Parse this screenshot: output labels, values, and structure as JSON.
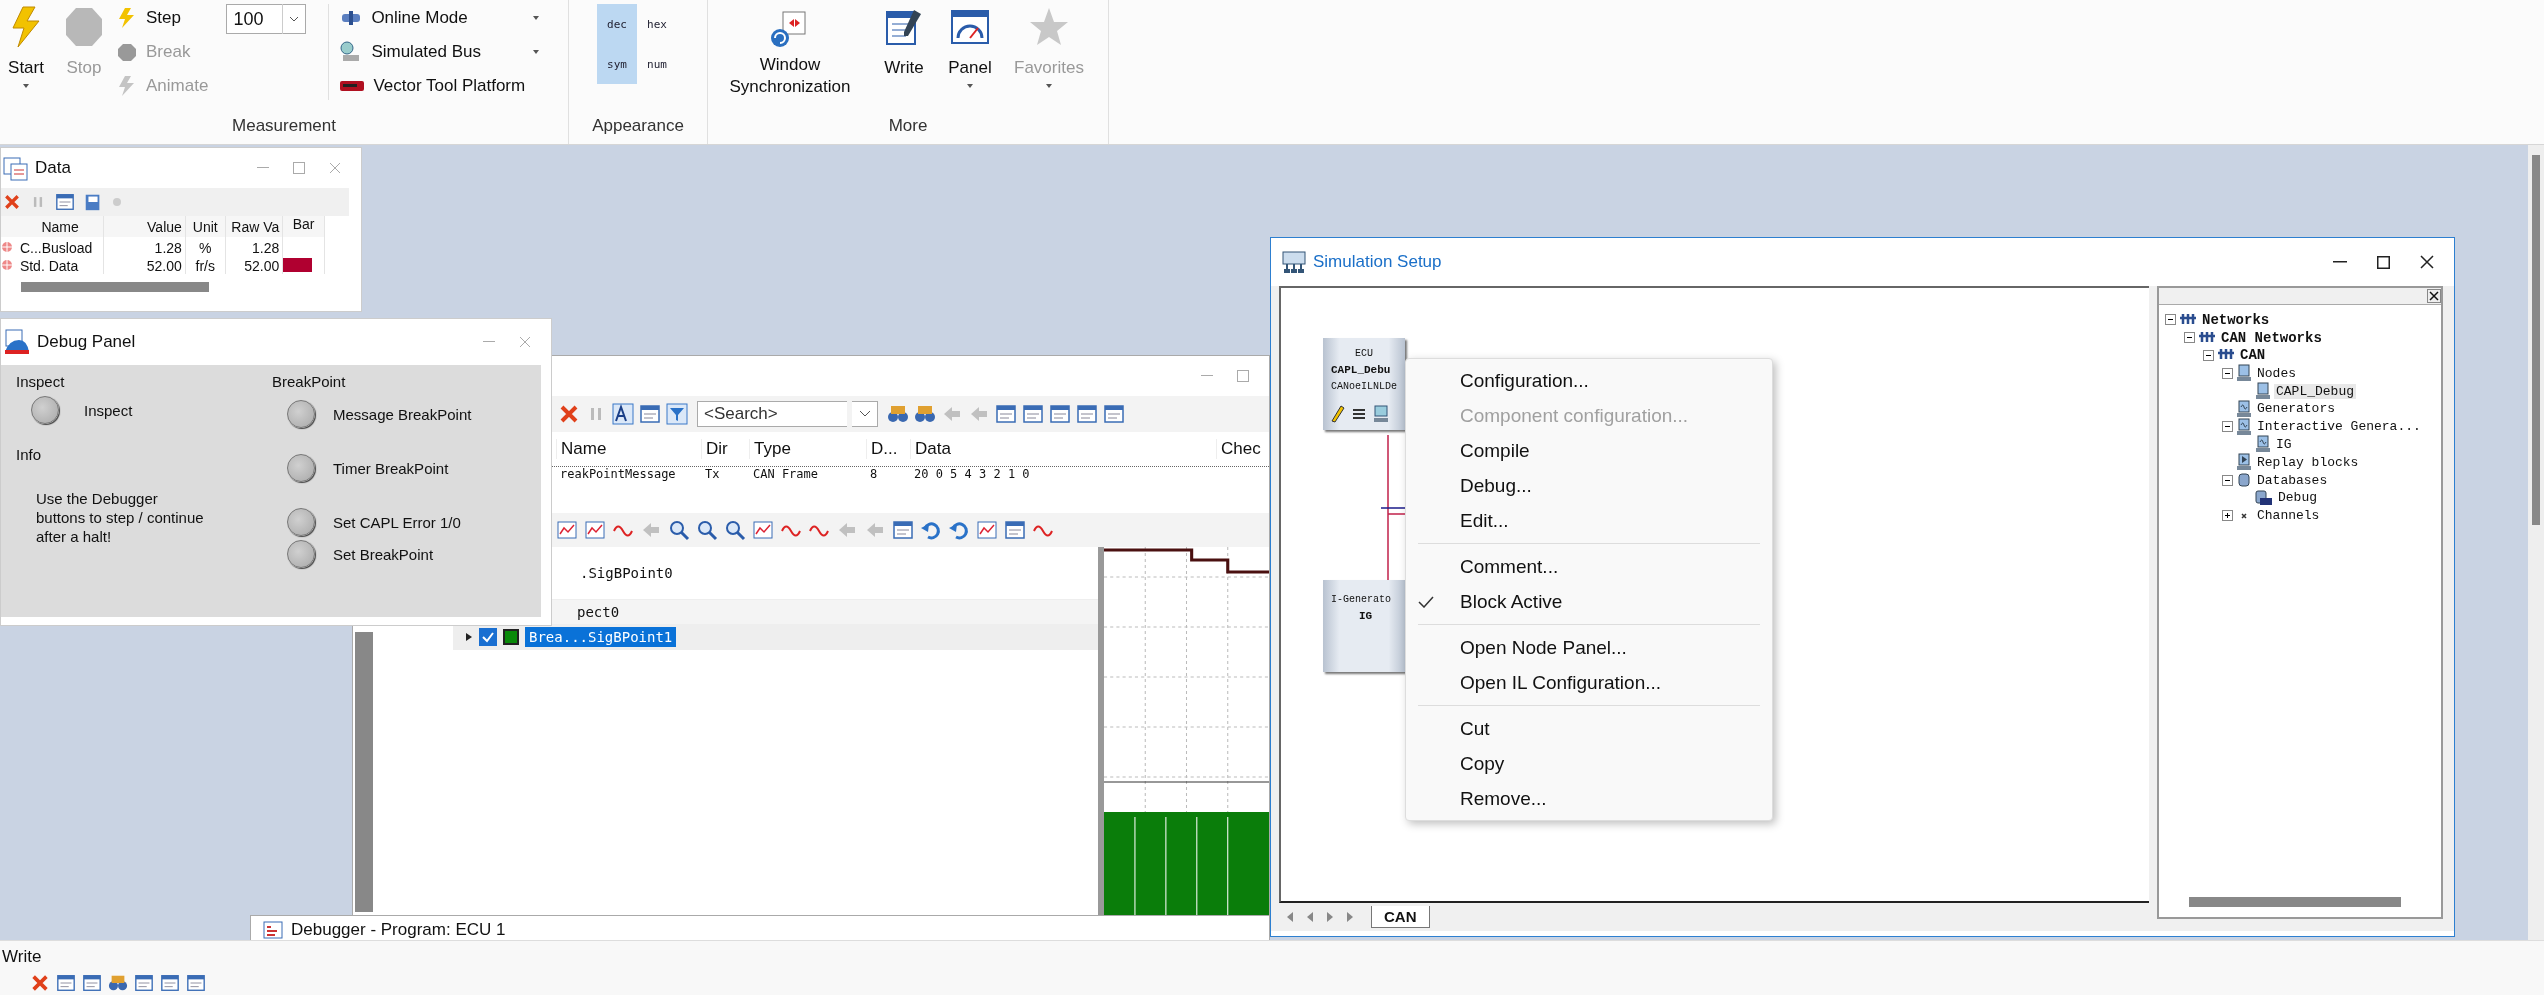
{
  "ribbon": {
    "groups": [
      {
        "label": "Measurement",
        "buttons": [
          {
            "label": "Start",
            "disabled": false,
            "menu": true
          },
          {
            "label": "Stop",
            "disabled": true,
            "menu": false
          }
        ],
        "steps": [
          {
            "label": "Step",
            "disabled": false
          },
          {
            "label": "Break",
            "disabled": true
          },
          {
            "label": "Animate",
            "disabled": true
          }
        ],
        "speed": {
          "value": "100"
        },
        "modes": [
          {
            "label": "Online Mode",
            "menu": true
          },
          {
            "label": "Simulated Bus",
            "menu": true
          },
          {
            "label": "Vector Tool Platform",
            "menu": false
          }
        ]
      },
      {
        "label": "Appearance",
        "formats": [
          {
            "label": "dec",
            "selected": true
          },
          {
            "label": "hex",
            "selected": false
          },
          {
            "label": "sym",
            "selected": true
          },
          {
            "label": "num",
            "selected": false
          }
        ]
      },
      {
        "label": "More",
        "buttons": [
          {
            "label": "Window Synchronization",
            "disabled": false,
            "menu": false
          },
          {
            "label": "Write",
            "disabled": false,
            "menu": false
          },
          {
            "label": "Panel",
            "disabled": false,
            "menu": true
          },
          {
            "label": "Favorites",
            "disabled": true,
            "menu": true
          }
        ]
      }
    ]
  },
  "data_window": {
    "title": "Data",
    "columns": [
      "Name",
      "Value",
      "Unit",
      "Raw Va",
      "Bar"
    ],
    "rows": [
      {
        "name": "C...Busload",
        "value": "1.28",
        "unit": "%",
        "raw": "1.28"
      },
      {
        "name": "Std. Data",
        "value": "52.00",
        "unit": "fr/s",
        "raw": "52.00",
        "level": 0.7
      }
    ]
  },
  "debug_panel": {
    "title": "Debug Panel",
    "inspect": {
      "label": "Inspect",
      "buttons": [
        "Inspect"
      ]
    },
    "info": {
      "label": "Info",
      "text": "Use the Debugger buttons to step / continue after a halt!"
    },
    "breakpoint": {
      "label": "BreakPoint",
      "buttons": [
        "Message BreakPoint",
        "Timer BreakPoint",
        "Set CAPL Error 1/0",
        "Set BreakPoint"
      ]
    }
  },
  "trace": {
    "search": {
      "placeholder": "<Search>"
    },
    "columns": [
      "Name",
      "Dir",
      "Type",
      "D...",
      "Data",
      "Chec"
    ],
    "row": [
      "reakPointMessage",
      "Tx",
      "CAN Frame",
      "8",
      "20   0   5   4   3   2   1   0"
    ]
  },
  "graphics": {
    "signals": [
      {
        "label": ".SigBPoint0",
        "selected": false
      },
      {
        "label": "pect0",
        "selected": false
      },
      {
        "label": "Brea...SigBPoint1",
        "selected": true,
        "checked": true
      }
    ]
  },
  "simulation_setup": {
    "title": "Simulation Setup",
    "blocks": [
      {
        "type": "ECU",
        "name": "CAPL_Debu",
        "db": "CANoeILNLDe"
      },
      {
        "type": "I-Generato",
        "name": "IG"
      }
    ],
    "context_menu": [
      {
        "kind": "item",
        "label": "Configuration...",
        "disabled": false,
        "checked": false
      },
      {
        "kind": "item",
        "label": "Component configuration...",
        "disabled": true,
        "checked": false
      },
      {
        "kind": "item",
        "label": "Compile",
        "disabled": false,
        "checked": false
      },
      {
        "kind": "item",
        "label": "Debug...",
        "disabled": false,
        "checked": false
      },
      {
        "kind": "item",
        "label": "Edit...",
        "disabled": false,
        "checked": false
      },
      {
        "kind": "separator"
      },
      {
        "kind": "item",
        "label": "Comment...",
        "disabled": false,
        "checked": false
      },
      {
        "kind": "item",
        "label": "Block Active",
        "disabled": false,
        "checked": true
      },
      {
        "kind": "separator"
      },
      {
        "kind": "item",
        "label": "Open Node Panel...",
        "disabled": false,
        "checked": false
      },
      {
        "kind": "item",
        "label": "Open IL Configuration...",
        "disabled": false,
        "checked": false
      },
      {
        "kind": "separator"
      },
      {
        "kind": "item",
        "label": "Cut",
        "disabled": false,
        "checked": false
      },
      {
        "kind": "item",
        "label": "Copy",
        "disabled": false,
        "checked": false
      },
      {
        "kind": "item",
        "label": "Remove...",
        "disabled": false,
        "checked": false
      }
    ],
    "tabs": [
      {
        "label": "CAN",
        "selected": true
      }
    ],
    "tree": [
      {
        "label": "Networks",
        "kind": "network",
        "expanded": true,
        "selected": false,
        "children": [
          {
            "label": "CAN Networks",
            "kind": "network",
            "expanded": true,
            "selected": false,
            "children": [
              {
                "label": "CAN",
                "kind": "network",
                "expanded": true,
                "selected": false,
                "children": [
                  {
                    "label": "Nodes",
                    "kind": "node",
                    "expanded": true,
                    "selected": false,
                    "children": [
                      {
                        "label": "CAPL_Debug",
                        "kind": "node",
                        "selected": true
                      }
                    ]
                  },
                  {
                    "label": "Generators",
                    "kind": "generator",
                    "selected": false
                  },
                  {
                    "label": "Interactive Genera...",
                    "kind": "generator",
                    "expanded": true,
                    "selected": false,
                    "children": [
                      {
                        "label": "IG",
                        "kind": "generator",
                        "selected": false
                      }
                    ]
                  },
                  {
                    "label": "Replay blocks",
                    "kind": "replay",
                    "selected": false
                  },
                  {
                    "label": "Databases",
                    "kind": "database",
                    "expanded": true,
                    "selected": false,
                    "children": [
                      {
                        "label": "Debug",
                        "kind": "dbc",
                        "selected": false
                      }
                    ]
                  },
                  {
                    "label": "Channels",
                    "kind": "channel",
                    "expanded": false,
                    "selected": false
                  }
                ]
              }
            ]
          }
        ]
      }
    ]
  },
  "debugger": {
    "title": "Debugger - Program: ECU 1"
  },
  "write_window": {
    "title": "Write"
  }
}
